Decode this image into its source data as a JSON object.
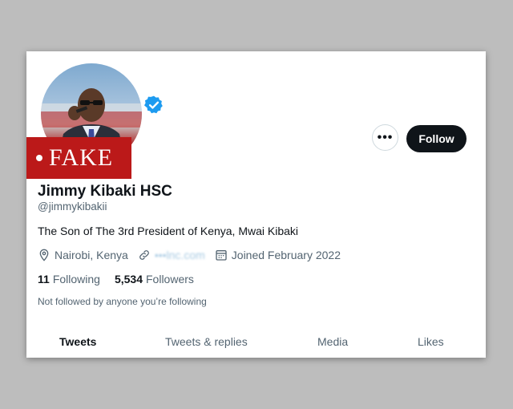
{
  "badge": {
    "text": "FAKE",
    "color": "#bb1919"
  },
  "profile": {
    "display_name": "Jimmy Kibaki HSC",
    "handle": "@jimmykibakii",
    "bio": "The Son of The 3rd President of Kenya, Mwai Kibaki",
    "location": "Nairobi, Kenya",
    "website": "•••lnc.com",
    "joined": "Joined February 2022",
    "verified_icon": "verified-badge-icon",
    "verified_color": "#1d9bf0"
  },
  "stats": {
    "following_count": "11",
    "following_label": "Following",
    "followers_count": "5,534",
    "followers_label": "Followers"
  },
  "not_followed_text": "Not followed by anyone you’re following",
  "actions": {
    "more_label": "•••",
    "follow_label": "Follow"
  },
  "tabs": [
    {
      "label": "Tweets",
      "active": true
    },
    {
      "label": "Tweets & replies",
      "active": false
    },
    {
      "label": "Media",
      "active": false
    },
    {
      "label": "Likes",
      "active": false
    }
  ],
  "colors": {
    "background": "#bdbdbd",
    "card": "#ffffff",
    "text_primary": "#0f1419",
    "text_secondary": "#536471"
  }
}
